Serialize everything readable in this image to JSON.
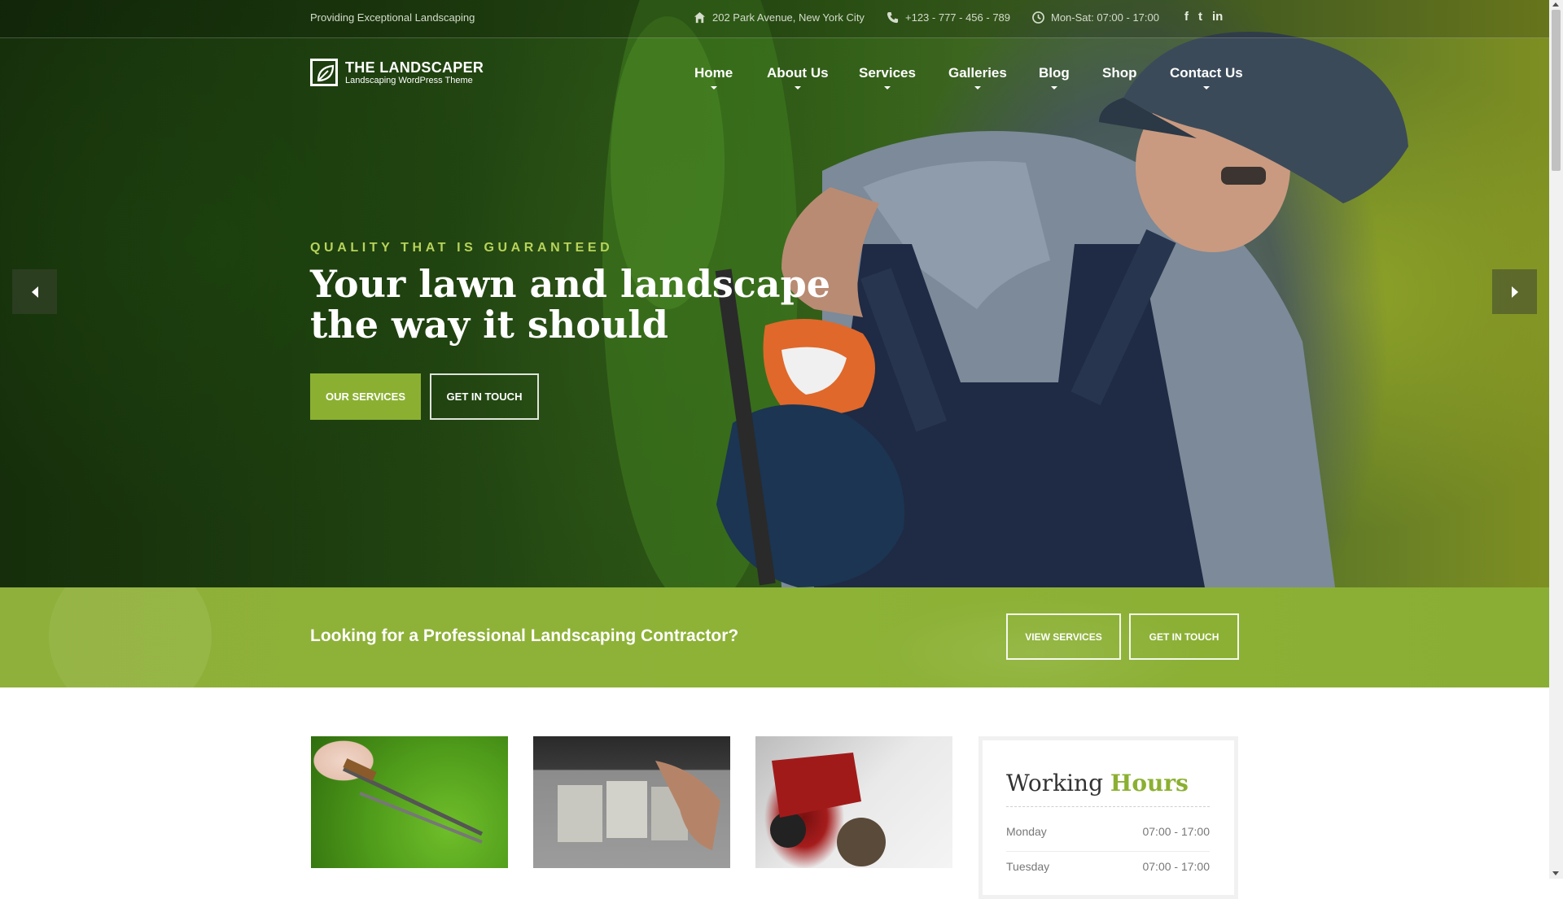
{
  "topbar": {
    "tagline": "Providing Exceptional Landscaping",
    "address": "202 Park Avenue, New York City",
    "phone": "+123 - 777 - 456 - 789",
    "hours": "Mon-Sat: 07:00 - 17:00",
    "social": [
      "f",
      "t",
      "in"
    ]
  },
  "logo": {
    "name": "THE LANDSCAPER",
    "subtitle": "Landscaping WordPress Theme"
  },
  "nav": {
    "items": [
      {
        "label": "Home",
        "has_dropdown": true
      },
      {
        "label": "About Us",
        "has_dropdown": true
      },
      {
        "label": "Services",
        "has_dropdown": true
      },
      {
        "label": "Galleries",
        "has_dropdown": true
      },
      {
        "label": "Blog",
        "has_dropdown": true
      },
      {
        "label": "Shop",
        "has_dropdown": false
      },
      {
        "label": "Contact Us",
        "has_dropdown": true
      }
    ]
  },
  "hero": {
    "eyebrow": "QUALITY THAT IS GUARANTEED",
    "headline_line1": "Your lawn and landscape",
    "headline_line2": "the way it should",
    "primary_button": "OUR SERVICES",
    "secondary_button": "GET IN TOUCH"
  },
  "cta": {
    "title": "Looking for a Professional Landscaping Contractor?",
    "view_services": "VIEW SERVICES",
    "get_in_touch": "GET IN TOUCH"
  },
  "working_hours": {
    "title_plain": "Working ",
    "title_accent": "Hours",
    "rows": [
      {
        "day": "Monday",
        "time": "07:00 - 17:00"
      },
      {
        "day": "Tuesday",
        "time": "07:00 - 17:00"
      }
    ]
  },
  "colors": {
    "accent": "#8bb031",
    "eyebrow": "#b7d35a",
    "cta_band": "#8db236"
  }
}
